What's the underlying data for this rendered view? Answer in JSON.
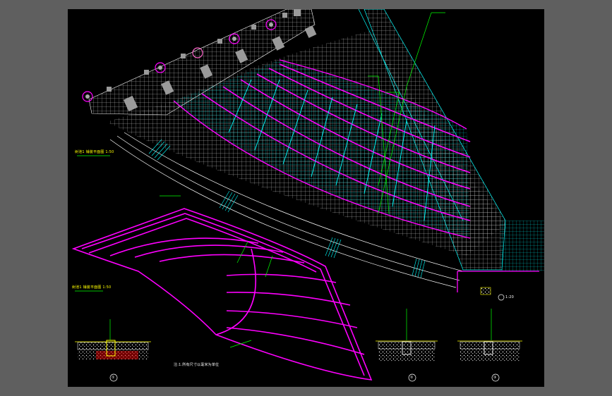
{
  "colors": {
    "background": "#5f5f5f",
    "canvas": "#000000",
    "magenta": "#ff00ff",
    "cyan": "#00ffff",
    "green": "#00ff00",
    "grid": "#d0d0d0",
    "white": "#ffffff",
    "yellow": "#ffff00",
    "red": "#ff0000",
    "pink": "#ff66cc",
    "gray_block": "#9a9a9a"
  },
  "drawing": {
    "plan_label_1": "树池1 铺装平面图 1:50",
    "plan_label_2": "树池1 铺装平面图 1:50",
    "note_text": "注:1.所有尺寸以毫米为单位",
    "detail_markers": [
      "①",
      "②",
      "③"
    ],
    "detail_scale": "1:20"
  }
}
